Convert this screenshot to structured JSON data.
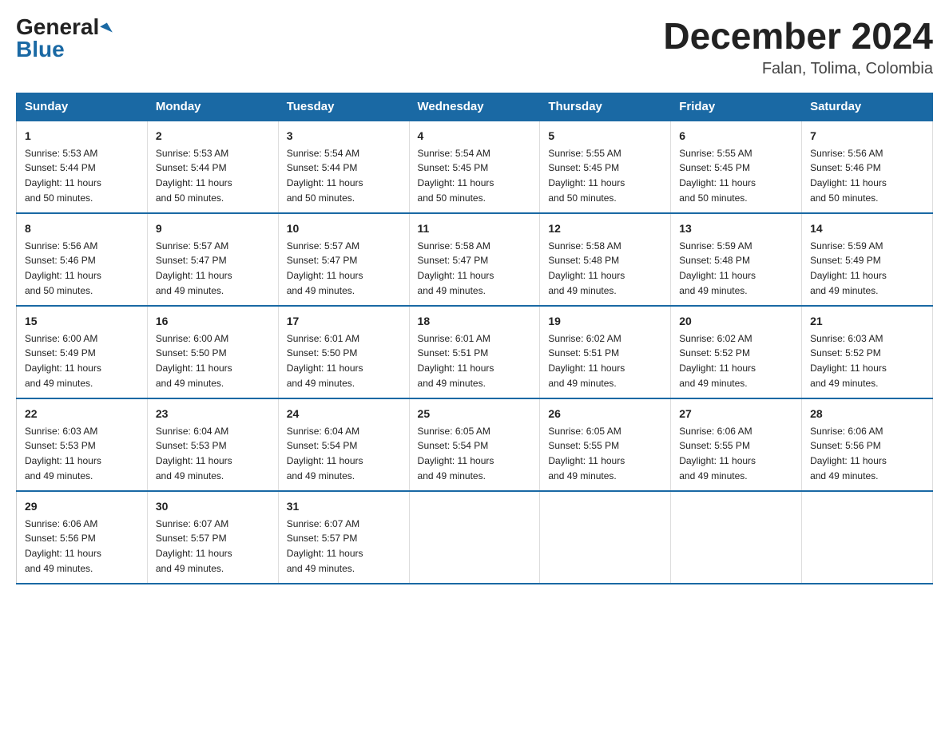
{
  "header": {
    "logo_general": "General",
    "logo_blue": "Blue",
    "month_title": "December 2024",
    "location": "Falan, Tolima, Colombia"
  },
  "days_of_week": [
    "Sunday",
    "Monday",
    "Tuesday",
    "Wednesday",
    "Thursday",
    "Friday",
    "Saturday"
  ],
  "weeks": [
    [
      {
        "day": "1",
        "sunrise": "5:53 AM",
        "sunset": "5:44 PM",
        "daylight": "11 hours and 50 minutes."
      },
      {
        "day": "2",
        "sunrise": "5:53 AM",
        "sunset": "5:44 PM",
        "daylight": "11 hours and 50 minutes."
      },
      {
        "day": "3",
        "sunrise": "5:54 AM",
        "sunset": "5:44 PM",
        "daylight": "11 hours and 50 minutes."
      },
      {
        "day": "4",
        "sunrise": "5:54 AM",
        "sunset": "5:45 PM",
        "daylight": "11 hours and 50 minutes."
      },
      {
        "day": "5",
        "sunrise": "5:55 AM",
        "sunset": "5:45 PM",
        "daylight": "11 hours and 50 minutes."
      },
      {
        "day": "6",
        "sunrise": "5:55 AM",
        "sunset": "5:45 PM",
        "daylight": "11 hours and 50 minutes."
      },
      {
        "day": "7",
        "sunrise": "5:56 AM",
        "sunset": "5:46 PM",
        "daylight": "11 hours and 50 minutes."
      }
    ],
    [
      {
        "day": "8",
        "sunrise": "5:56 AM",
        "sunset": "5:46 PM",
        "daylight": "11 hours and 50 minutes."
      },
      {
        "day": "9",
        "sunrise": "5:57 AM",
        "sunset": "5:47 PM",
        "daylight": "11 hours and 49 minutes."
      },
      {
        "day": "10",
        "sunrise": "5:57 AM",
        "sunset": "5:47 PM",
        "daylight": "11 hours and 49 minutes."
      },
      {
        "day": "11",
        "sunrise": "5:58 AM",
        "sunset": "5:47 PM",
        "daylight": "11 hours and 49 minutes."
      },
      {
        "day": "12",
        "sunrise": "5:58 AM",
        "sunset": "5:48 PM",
        "daylight": "11 hours and 49 minutes."
      },
      {
        "day": "13",
        "sunrise": "5:59 AM",
        "sunset": "5:48 PM",
        "daylight": "11 hours and 49 minutes."
      },
      {
        "day": "14",
        "sunrise": "5:59 AM",
        "sunset": "5:49 PM",
        "daylight": "11 hours and 49 minutes."
      }
    ],
    [
      {
        "day": "15",
        "sunrise": "6:00 AM",
        "sunset": "5:49 PM",
        "daylight": "11 hours and 49 minutes."
      },
      {
        "day": "16",
        "sunrise": "6:00 AM",
        "sunset": "5:50 PM",
        "daylight": "11 hours and 49 minutes."
      },
      {
        "day": "17",
        "sunrise": "6:01 AM",
        "sunset": "5:50 PM",
        "daylight": "11 hours and 49 minutes."
      },
      {
        "day": "18",
        "sunrise": "6:01 AM",
        "sunset": "5:51 PM",
        "daylight": "11 hours and 49 minutes."
      },
      {
        "day": "19",
        "sunrise": "6:02 AM",
        "sunset": "5:51 PM",
        "daylight": "11 hours and 49 minutes."
      },
      {
        "day": "20",
        "sunrise": "6:02 AM",
        "sunset": "5:52 PM",
        "daylight": "11 hours and 49 minutes."
      },
      {
        "day": "21",
        "sunrise": "6:03 AM",
        "sunset": "5:52 PM",
        "daylight": "11 hours and 49 minutes."
      }
    ],
    [
      {
        "day": "22",
        "sunrise": "6:03 AM",
        "sunset": "5:53 PM",
        "daylight": "11 hours and 49 minutes."
      },
      {
        "day": "23",
        "sunrise": "6:04 AM",
        "sunset": "5:53 PM",
        "daylight": "11 hours and 49 minutes."
      },
      {
        "day": "24",
        "sunrise": "6:04 AM",
        "sunset": "5:54 PM",
        "daylight": "11 hours and 49 minutes."
      },
      {
        "day": "25",
        "sunrise": "6:05 AM",
        "sunset": "5:54 PM",
        "daylight": "11 hours and 49 minutes."
      },
      {
        "day": "26",
        "sunrise": "6:05 AM",
        "sunset": "5:55 PM",
        "daylight": "11 hours and 49 minutes."
      },
      {
        "day": "27",
        "sunrise": "6:06 AM",
        "sunset": "5:55 PM",
        "daylight": "11 hours and 49 minutes."
      },
      {
        "day": "28",
        "sunrise": "6:06 AM",
        "sunset": "5:56 PM",
        "daylight": "11 hours and 49 minutes."
      }
    ],
    [
      {
        "day": "29",
        "sunrise": "6:06 AM",
        "sunset": "5:56 PM",
        "daylight": "11 hours and 49 minutes."
      },
      {
        "day": "30",
        "sunrise": "6:07 AM",
        "sunset": "5:57 PM",
        "daylight": "11 hours and 49 minutes."
      },
      {
        "day": "31",
        "sunrise": "6:07 AM",
        "sunset": "5:57 PM",
        "daylight": "11 hours and 49 minutes."
      },
      null,
      null,
      null,
      null
    ]
  ],
  "labels": {
    "sunrise": "Sunrise:",
    "sunset": "Sunset:",
    "daylight": "Daylight:"
  }
}
